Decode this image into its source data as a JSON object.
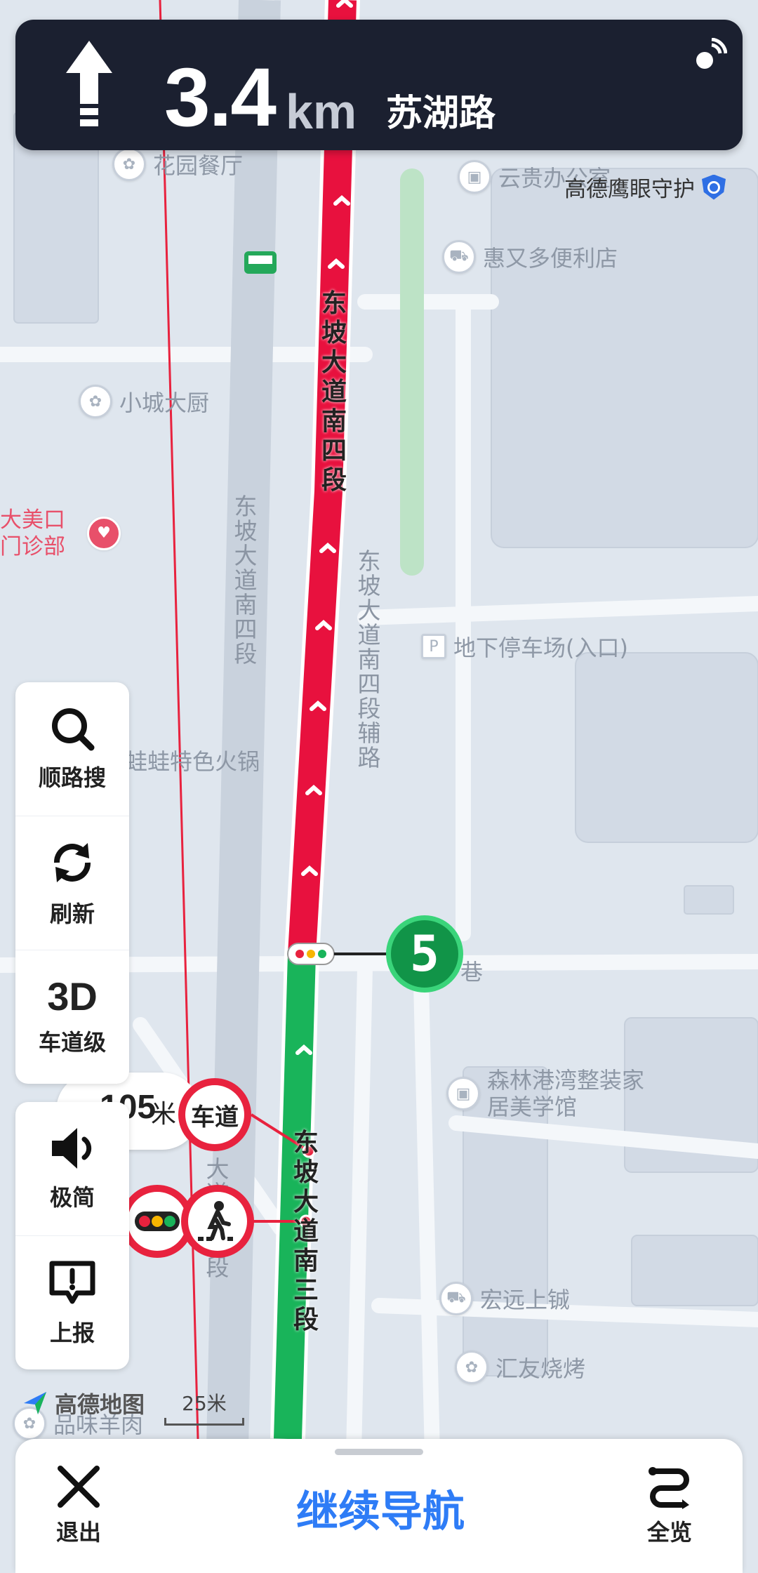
{
  "banner": {
    "distance": "3.4",
    "unit": "km",
    "next_road": "苏湖路"
  },
  "eye_guard": {
    "label": "高德鹰眼守护"
  },
  "pois": [
    {
      "name": "花园餐厅",
      "icon": "restaurant-icon"
    },
    {
      "name": "云贵办公室",
      "icon": "building-icon"
    },
    {
      "name": "惠又多便利店",
      "icon": "shopping-cart-icon"
    },
    {
      "name": "小城大厨",
      "icon": "restaurant-icon"
    },
    {
      "name": "大美口门诊部",
      "icon": "tooth-icon"
    },
    {
      "name": "地下停车场(入口)",
      "icon": "parking-icon"
    },
    {
      "name": "蛙蛙特色火锅",
      "icon": "restaurant-icon"
    },
    {
      "name": "森林港湾整装家居美学馆",
      "icon": "building-icon"
    },
    {
      "name": "宏远上铖",
      "icon": "shopping-cart-icon"
    },
    {
      "name": "汇友烧烤",
      "icon": "restaurant-icon"
    },
    {
      "name": "品味羊肉",
      "icon": "restaurant-icon"
    },
    {
      "name": "巷",
      "icon": ""
    }
  ],
  "roads": {
    "route_upper": "东坡大道南四段",
    "side_left": "东坡大道南四段",
    "side_right": "东坡大道南四段辅路",
    "route_lower": "东坡大道南三段",
    "left_lower": "大道南三段"
  },
  "side_panel": {
    "search_along": "顺路搜",
    "refresh": "刷新",
    "view_3d_icon": "3D",
    "lane_level": "车道级",
    "minimal": "极简",
    "report": "上报"
  },
  "signs": {
    "distance_value": "105",
    "distance_unit": "米",
    "lane_sign": "车道"
  },
  "signal_countdown": "5",
  "map_footer": {
    "logo": "高德地图",
    "scale": "25米"
  },
  "bottom_bar": {
    "exit": "退出",
    "continue": "继续导航",
    "overview": "全览"
  },
  "colors": {
    "congestion": "#e8113e",
    "clear": "#19b45a",
    "banner_bg": "#1b2030",
    "accent": "#2e7cf6"
  }
}
